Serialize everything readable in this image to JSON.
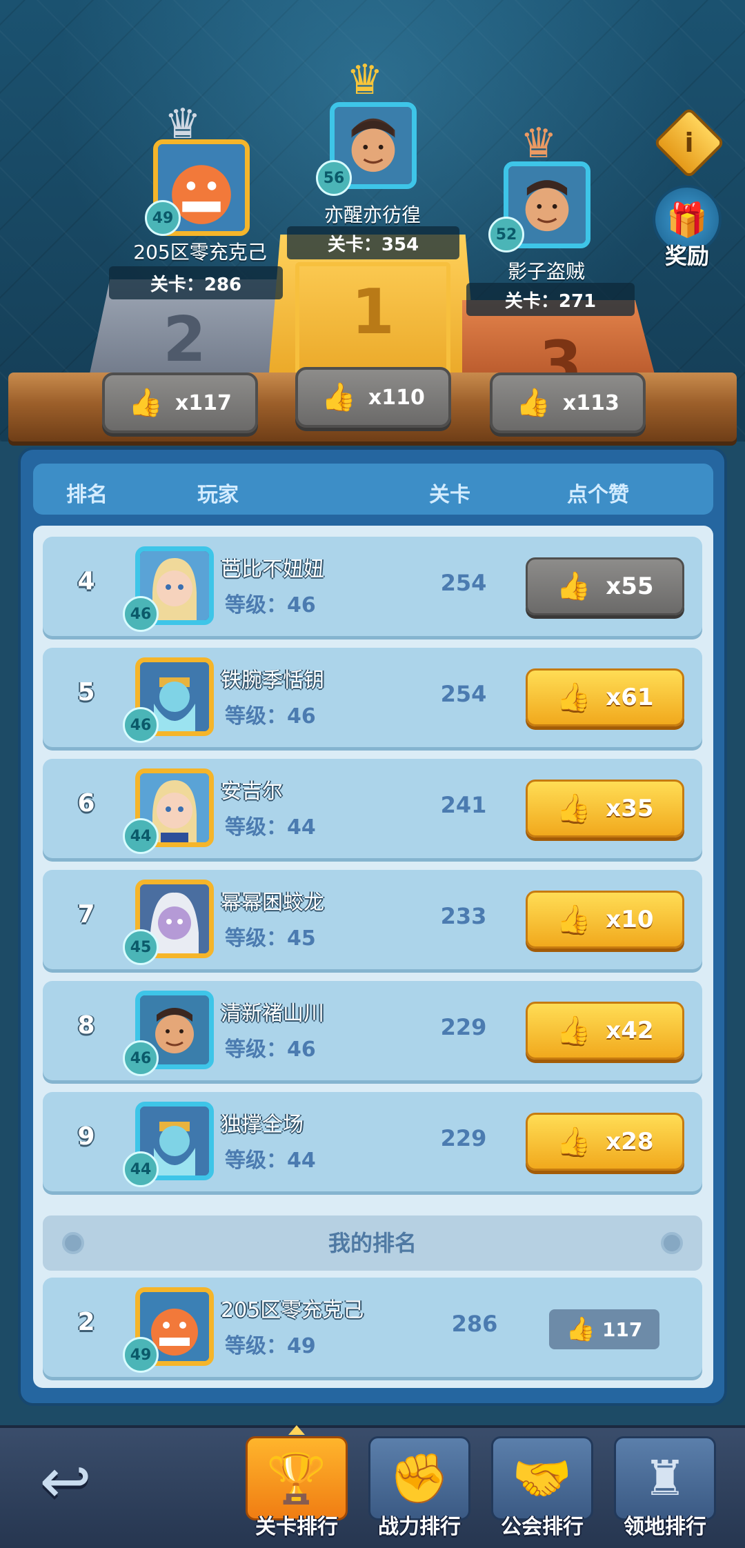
{
  "podium": [
    {
      "place": "2",
      "name": "205区零充克己",
      "level": "49",
      "stage_label": "关卡：286",
      "likes": "x117",
      "crown": "silver"
    },
    {
      "place": "1",
      "name": "亦醒亦彷徨",
      "level": "56",
      "stage_label": "关卡：354",
      "likes": "x110",
      "crown": "gold"
    },
    {
      "place": "3",
      "name": "影子盗贼",
      "level": "52",
      "stage_label": "关卡：271",
      "likes": "x113",
      "crown": "bronze"
    }
  ],
  "reward_label": "奖励",
  "info_icon_text": "i",
  "table": {
    "headers": {
      "rank": "排名",
      "player": "玩家",
      "stage": "关卡",
      "like": "点个赞"
    },
    "rows": [
      {
        "rank": "4",
        "name": "芭比不妞妞",
        "level": "46",
        "grade": "等级：46",
        "stage": "254",
        "likes": "x55",
        "liked": true
      },
      {
        "rank": "5",
        "name": "铁腕季恬钥",
        "level": "46",
        "grade": "等级：46",
        "stage": "254",
        "likes": "x61",
        "liked": false
      },
      {
        "rank": "6",
        "name": "安吉尔",
        "level": "44",
        "grade": "等级：44",
        "stage": "241",
        "likes": "x35",
        "liked": false
      },
      {
        "rank": "7",
        "name": "幂幂困蛟龙",
        "level": "45",
        "grade": "等级：45",
        "stage": "233",
        "likes": "x10",
        "liked": false
      },
      {
        "rank": "8",
        "name": "清新褚山川",
        "level": "46",
        "grade": "等级：46",
        "stage": "229",
        "likes": "x42",
        "liked": false
      },
      {
        "rank": "9",
        "name": "独撑全场",
        "level": "44",
        "grade": "等级：44",
        "stage": "229",
        "likes": "x28",
        "liked": false
      }
    ]
  },
  "my_rank": {
    "title": "我的排名",
    "rank": "2",
    "name": "205区零充克己",
    "level": "49",
    "grade": "等级：49",
    "stage": "286",
    "likes": "117"
  },
  "nav": {
    "tabs": [
      {
        "label": "关卡排行",
        "active": true
      },
      {
        "label": "战力排行",
        "active": false
      },
      {
        "label": "公会排行",
        "active": false
      },
      {
        "label": "领地排行",
        "active": false
      }
    ]
  },
  "colors": {
    "accent_gold": "#f1a91d",
    "panel_blue": "#2566a0",
    "row_blue": "#acd4ea"
  }
}
